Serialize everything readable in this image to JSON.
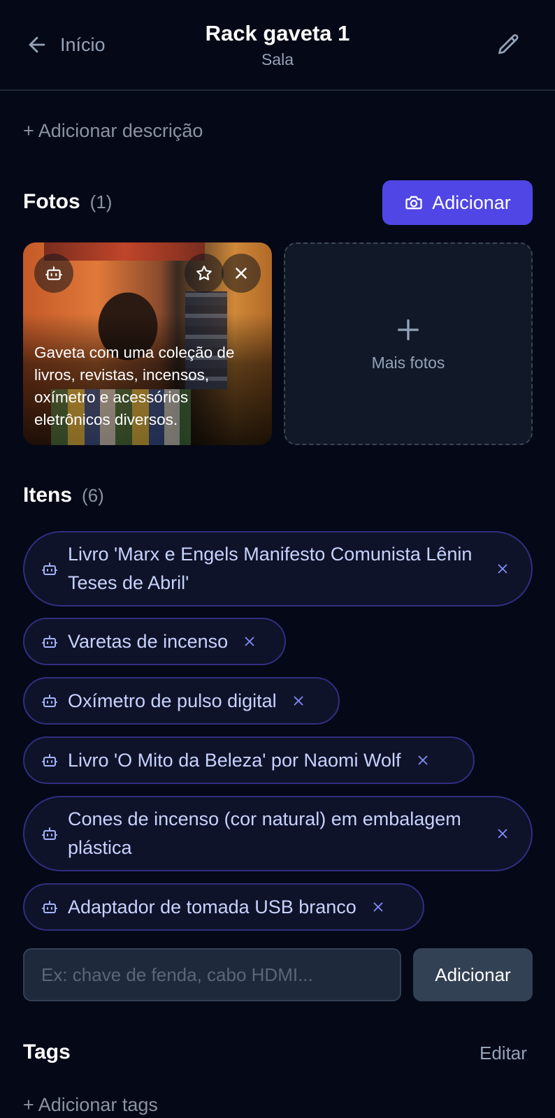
{
  "header": {
    "back_label": "Início",
    "title": "Rack gaveta 1",
    "subtitle": "Sala"
  },
  "description": {
    "add_label": "+ Adicionar descrição"
  },
  "photos": {
    "title": "Fotos",
    "count": "(1)",
    "add_button": "Adicionar",
    "items": [
      {
        "caption": "Gaveta com uma coleção de livros, revistas, incensos, oxímetro e acessórios eletrônicos diversos."
      }
    ],
    "more_label": "Mais fotos"
  },
  "items": {
    "title": "Itens",
    "count": "(6)",
    "list": [
      {
        "label": "Livro 'Marx e Engels Manifesto Comunista Lênin Teses de Abril'"
      },
      {
        "label": "Varetas de incenso"
      },
      {
        "label": "Oxímetro de pulso digital"
      },
      {
        "label": "Livro 'O Mito da Beleza' por Naomi Wolf"
      },
      {
        "label": "Cones de incenso (cor natural) em embalagem plástica"
      },
      {
        "label": "Adaptador de tomada USB branco"
      }
    ],
    "input_placeholder": "Ex: chave de fenda, cabo HDMI...",
    "input_value": "",
    "add_button": "Adicionar"
  },
  "tags": {
    "title": "Tags",
    "edit_label": "Editar",
    "add_label": "+ Adicionar tags"
  },
  "colors": {
    "background": "#050816",
    "accent": "#4f46e5",
    "chip_border": "#312e81",
    "chip_text": "#c7d2fe"
  },
  "icons": [
    "arrow-left-icon",
    "pencil-icon",
    "camera-icon",
    "robot-icon",
    "star-icon",
    "close-icon",
    "plus-icon"
  ]
}
